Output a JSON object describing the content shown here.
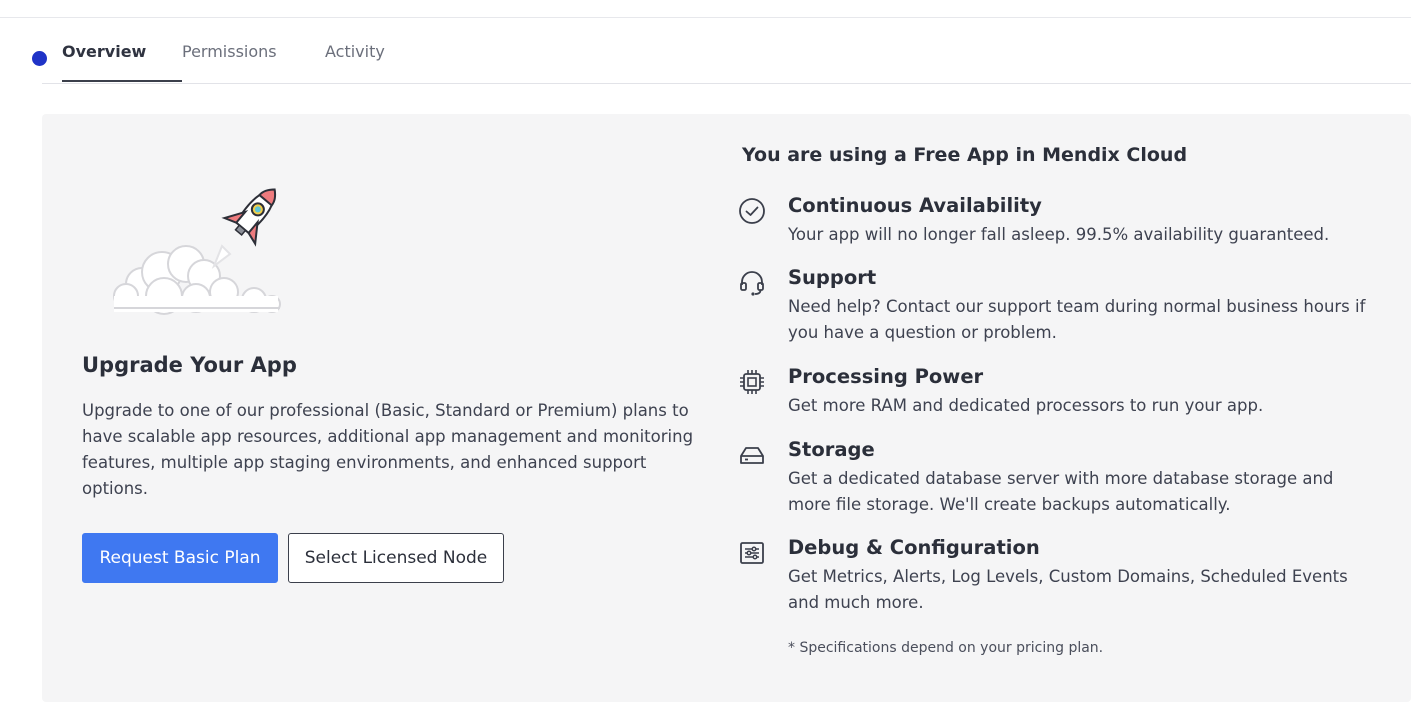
{
  "tabs": [
    {
      "label": "Overview",
      "active": true
    },
    {
      "label": "Permissions",
      "active": false
    },
    {
      "label": "Activity",
      "active": false
    }
  ],
  "colors": {
    "status_dot": "#1f33c7",
    "primary_button": "#3f78f1",
    "panel_background": "#f5f5f6"
  },
  "upgrade": {
    "illustration": "rocket-launch-illustration",
    "title": "Upgrade Your App",
    "description": "Upgrade to one of our professional (Basic, Standard or Premium) plans to have scalable app resources, additional app management and monitoring features, multiple app staging environments, and enhanced support options.",
    "primary_button": "Request Basic Plan",
    "secondary_button": "Select Licensed Node"
  },
  "free_app": {
    "title": "You are using a Free App in Mendix Cloud",
    "features": [
      {
        "icon": "check-circle-icon",
        "title": "Continuous Availability",
        "description": "Your app will no longer fall asleep. 99.5% availability guaranteed."
      },
      {
        "icon": "headset-icon",
        "title": "Support",
        "description": "Need help? Contact our support team during normal business hours if you have a question or problem."
      },
      {
        "icon": "cpu-chip-icon",
        "title": "Processing Power",
        "description": "Get more RAM and dedicated processors to run your app."
      },
      {
        "icon": "hard-drive-icon",
        "title": "Storage",
        "description": "Get a dedicated database server with more database storage and more file storage. We'll create backups automatically."
      },
      {
        "icon": "settings-sliders-icon",
        "title": "Debug & Configuration",
        "description": "Get Metrics, Alerts, Log Levels, Custom Domains, Scheduled Events and much more."
      }
    ],
    "footnote": "* Specifications depend on your pricing plan."
  }
}
